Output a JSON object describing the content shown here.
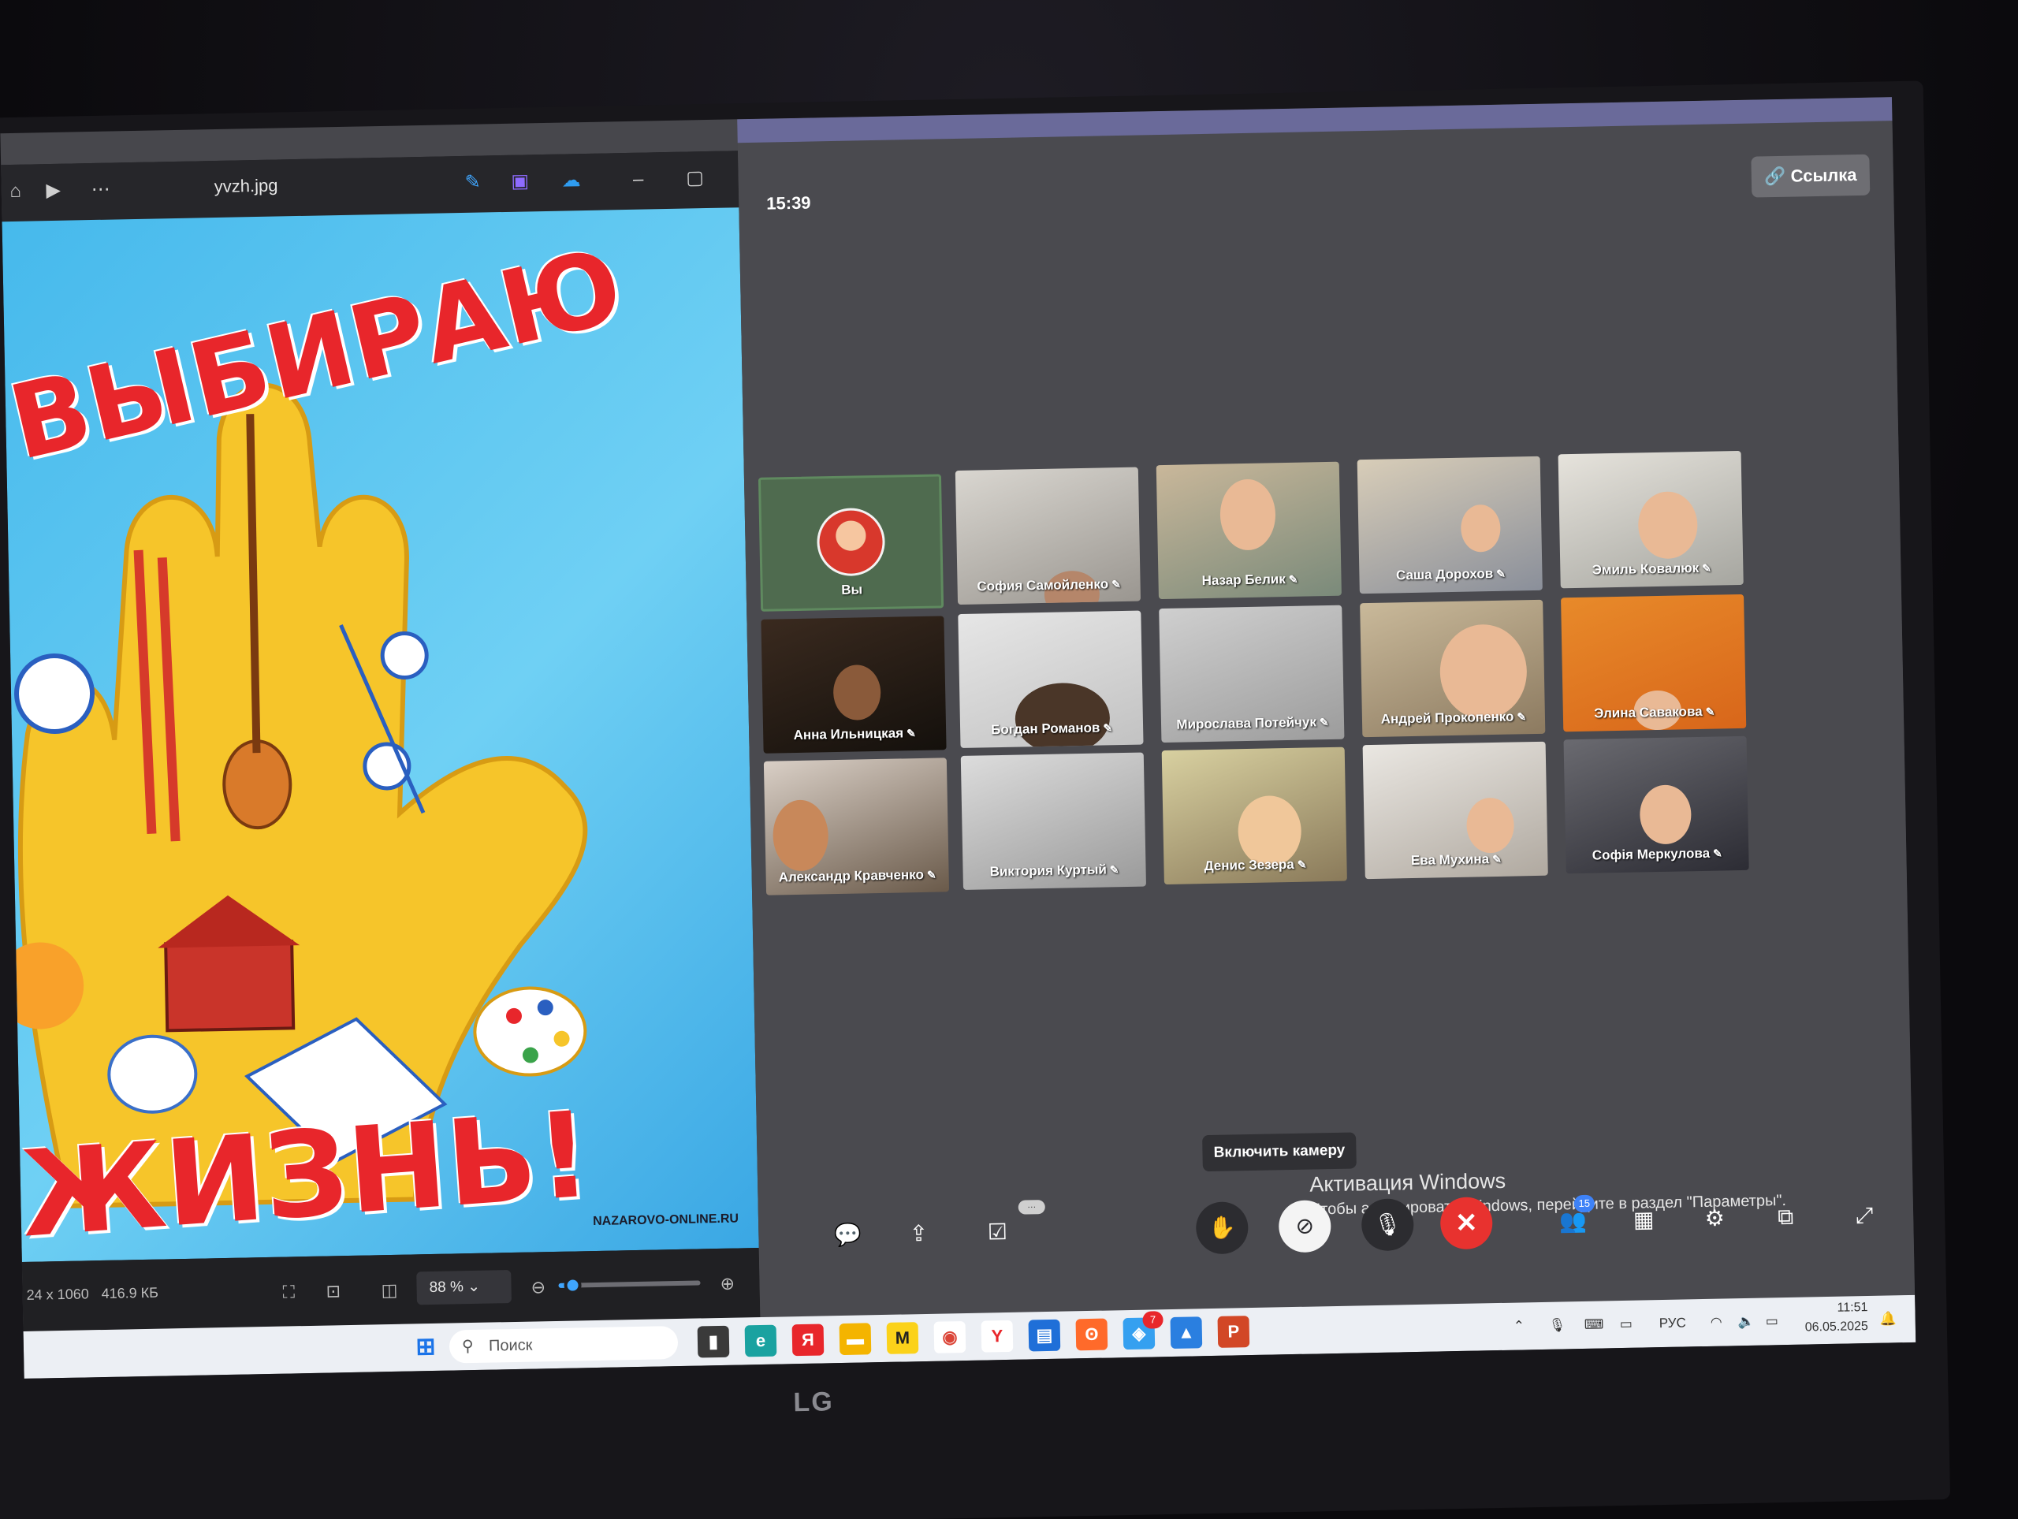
{
  "viewer": {
    "filename": "yvzh.jpg",
    "resolution": "24 x 1060",
    "filesize": "416.9 КБ",
    "zoom": "88 %",
    "zoom_level_fraction": 0.1,
    "poster_line1": "ВЫБИРАЮ",
    "poster_line2": "ЖИЗНЬ!",
    "watermark": "NAZAROVO-ONLINE.RU"
  },
  "meeting": {
    "time": "15:39",
    "link_button": "🔗 Ссылка",
    "participants": [
      "Вы",
      "София Самойленко",
      "Назар Белик",
      "Саша Дорохов",
      "Эмиль Ковалюк",
      "Анна Ильницкая",
      "Богдан Романов",
      "Мирослава Потейчук",
      "Андрей Прокопенко",
      "Элина Савакова",
      "Александр Кравченко",
      "Виктория Куртый",
      "Денис Зезера",
      "Ева Мухина",
      "Софія Меркулова"
    ],
    "tooltip": "Включить камеру",
    "participants_badge": "15",
    "activation_title": "Активация Windows",
    "activation_text": "Чтобы активировать Windows, перейдите в раздел \"Параметры\"."
  },
  "taskbar": {
    "search_placeholder": "Поиск",
    "language": "РУС",
    "time": "11:51",
    "date": "06.05.2025",
    "notification_badge": "7"
  },
  "monitor_brand": "LG"
}
